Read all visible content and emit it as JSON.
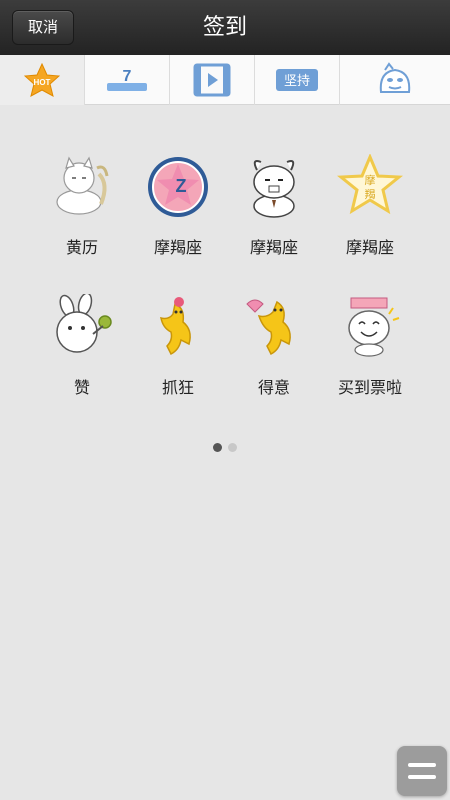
{
  "header": {
    "title": "签到",
    "cancel_label": "取消"
  },
  "tabs": [
    {
      "icon": "hot-star-icon",
      "text": "HOT",
      "selected": true
    },
    {
      "icon": "kanji-7-icon",
      "text": "7",
      "selected": false
    },
    {
      "icon": "video-icon",
      "selected": false
    },
    {
      "icon": "jianchi-icon",
      "text": "坚持",
      "selected": false
    },
    {
      "icon": "cartoon-face-icon",
      "selected": false
    }
  ],
  "stickers": [
    {
      "label": "黄历",
      "icon": "cat-meditating-icon"
    },
    {
      "label": "摩羯座",
      "icon": "capricorn-badge-icon"
    },
    {
      "label": "摩羯座",
      "icon": "goat-cat-icon"
    },
    {
      "label": "摩羯座",
      "icon": "gold-star-seal-icon"
    },
    {
      "label": "赞",
      "icon": "rabbit-thumbs-icon"
    },
    {
      "label": "抓狂",
      "icon": "yellow-dancer-icon"
    },
    {
      "label": "得意",
      "icon": "yellow-fan-dancer-icon"
    },
    {
      "label": "买到票啦",
      "icon": "cat-ticket-icon"
    }
  ],
  "pager": {
    "pages": 2,
    "current": 1
  },
  "colors": {
    "topbar": "#2e2e2e",
    "background": "#e6e6e6",
    "star": "#f5a623",
    "tab_icon_blue": "#6f9fd6"
  }
}
